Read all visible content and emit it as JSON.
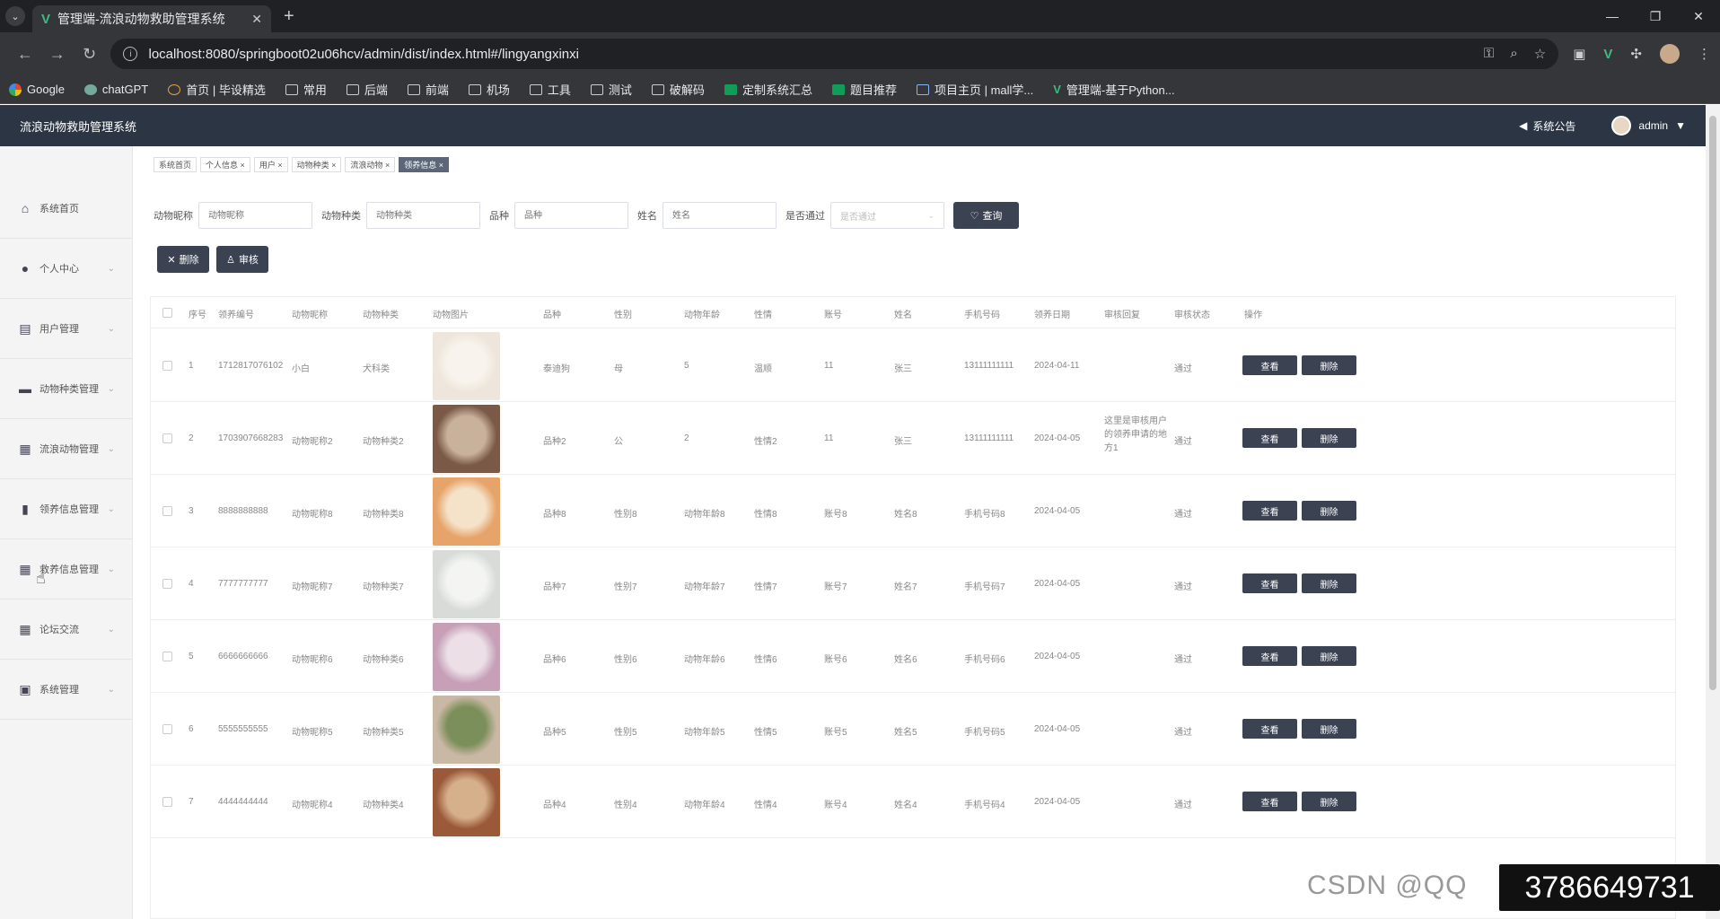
{
  "browser": {
    "tab_title": "管理端-流浪动物救助管理系统",
    "url": "localhost:8080/springboot02u06hcv/admin/dist/index.html#/lingyangxinxi",
    "bookmarks": [
      "Google",
      "chatGPT",
      "首页 | 毕设精选",
      "常用",
      "后端",
      "前端",
      "机场",
      "工具",
      "测试",
      "破解码",
      "定制系统汇总",
      "题目推荐",
      "项目主页 | mall学...",
      "管理端-基于Python..."
    ]
  },
  "header": {
    "title": "流浪动物救助管理系统",
    "notice": "系统公告",
    "user": "admin"
  },
  "sidebar": {
    "items": [
      {
        "label": "系统首页",
        "icon": "home-icon"
      },
      {
        "label": "个人中心",
        "icon": "user-icon"
      },
      {
        "label": "用户管理",
        "icon": "clipboard-icon"
      },
      {
        "label": "动物种类管理",
        "icon": "chat-icon"
      },
      {
        "label": "流浪动物管理",
        "icon": "grid-icon"
      },
      {
        "label": "领养信息管理",
        "icon": "bar-chart-icon"
      },
      {
        "label": "救养信息管理",
        "icon": "grid-icon"
      },
      {
        "label": "论坛交流",
        "icon": "grid-icon"
      },
      {
        "label": "系统管理",
        "icon": "clipboard-x-icon"
      }
    ]
  },
  "tags": [
    "系统首页",
    "个人信息",
    "用户",
    "动物种类",
    "流浪动物",
    "领养信息"
  ],
  "search": {
    "fields": [
      {
        "label": "动物昵称",
        "placeholder": "动物昵称"
      },
      {
        "label": "动物种类",
        "placeholder": "动物种类"
      },
      {
        "label": "品种",
        "placeholder": "品种"
      },
      {
        "label": "姓名",
        "placeholder": "姓名"
      }
    ],
    "select": {
      "label": "是否通过",
      "placeholder": "是否通过"
    },
    "query": "查询"
  },
  "actions": {
    "delete": "删除",
    "review": "审核"
  },
  "table": {
    "headers": [
      "序号",
      "领养编号",
      "动物昵称",
      "动物种类",
      "动物图片",
      "品种",
      "性别",
      "动物年龄",
      "性情",
      "账号",
      "姓名",
      "手机号码",
      "领养日期",
      "审核回复",
      "审核状态",
      "操作"
    ],
    "view_label": "查看",
    "delete_label": "删除",
    "rows": [
      {
        "no": "1",
        "id": "1712817076102",
        "name": "小白",
        "kind": "犬科类",
        "breed": "泰迪狗",
        "sex": "母",
        "age": "5",
        "temper": "温顺",
        "account": "11",
        "person": "张三",
        "phone": "13111111111",
        "date": "2024-04-11",
        "reply": "",
        "status": "通过"
      },
      {
        "no": "2",
        "id": "1703907668283",
        "name": "动物昵称2",
        "kind": "动物种类2",
        "breed": "品种2",
        "sex": "公",
        "age": "2",
        "temper": "性情2",
        "account": "11",
        "person": "张三",
        "phone": "13111111111",
        "date": "2024-04-05",
        "reply": "这里是审核用户的领养申请的地方1",
        "status": "通过"
      },
      {
        "no": "3",
        "id": "8888888888",
        "name": "动物昵称8",
        "kind": "动物种类8",
        "breed": "品种8",
        "sex": "性别8",
        "age": "动物年龄8",
        "temper": "性情8",
        "account": "账号8",
        "person": "姓名8",
        "phone": "手机号码8",
        "date": "2024-04-05",
        "reply": "",
        "status": "通过"
      },
      {
        "no": "4",
        "id": "7777777777",
        "name": "动物昵称7",
        "kind": "动物种类7",
        "breed": "品种7",
        "sex": "性别7",
        "age": "动物年龄7",
        "temper": "性情7",
        "account": "账号7",
        "person": "姓名7",
        "phone": "手机号码7",
        "date": "2024-04-05",
        "reply": "",
        "status": "通过"
      },
      {
        "no": "5",
        "id": "6666666666",
        "name": "动物昵称6",
        "kind": "动物种类6",
        "breed": "品种6",
        "sex": "性别6",
        "age": "动物年龄6",
        "temper": "性情6",
        "account": "账号6",
        "person": "姓名6",
        "phone": "手机号码6",
        "date": "2024-04-05",
        "reply": "",
        "status": "通过"
      },
      {
        "no": "6",
        "id": "5555555555",
        "name": "动物昵称5",
        "kind": "动物种类5",
        "breed": "品种5",
        "sex": "性别5",
        "age": "动物年龄5",
        "temper": "性情5",
        "account": "账号5",
        "person": "姓名5",
        "phone": "手机号码5",
        "date": "2024-04-05",
        "reply": "",
        "status": "通过"
      },
      {
        "no": "7",
        "id": "4444444444",
        "name": "动物昵称4",
        "kind": "动物种类4",
        "breed": "品种4",
        "sex": "性别4",
        "age": "动物年龄4",
        "temper": "性情4",
        "account": "账号4",
        "person": "姓名4",
        "phone": "手机号码4",
        "date": "2024-04-05",
        "reply": "",
        "status": "通过"
      }
    ]
  },
  "watermark": {
    "text": "CSDN @QQ",
    "badge": "3786649731"
  }
}
